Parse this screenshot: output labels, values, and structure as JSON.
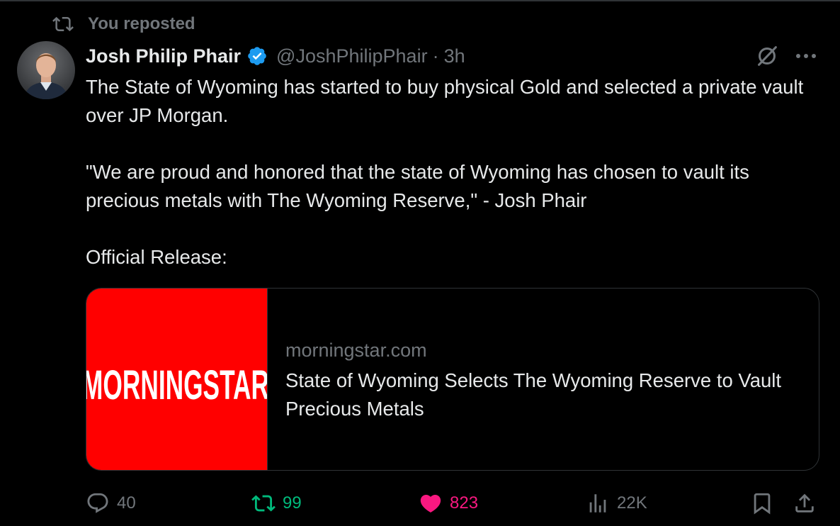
{
  "repost_banner": {
    "text": "You reposted",
    "icon": "repost-icon"
  },
  "author": {
    "display_name": "Josh Philip Phair",
    "handle": "@JoshPhilipPhair",
    "separator": "·",
    "time": "3h",
    "verified": true,
    "avatar": "avatar"
  },
  "tweet": {
    "paragraphs": [
      "The State of Wyoming has started to buy physical Gold and selected a private vault over JP Morgan.",
      "\"We are proud and honored that the state of Wyoming has chosen to vault its precious metals with The Wyoming Reserve,\" - Josh Phair",
      "Official Release:"
    ]
  },
  "card": {
    "thumbnail_logo": "MORNINGSTAR",
    "domain": "morningstar.com",
    "title": "State of Wyoming Selects The Wyoming Reserve to Vault Precious Metals"
  },
  "actions": {
    "reply_count": "40",
    "retweet_count": "99",
    "like_count": "823",
    "views_count": "22K"
  },
  "colors": {
    "background": "#000000",
    "text": "#e7e9ea",
    "muted": "#71767b",
    "retweet_active": "#00ba7c",
    "like_active": "#f91880",
    "verified": "#1d9bf0",
    "card_thumb": "#ff0000",
    "border": "#2f3336"
  }
}
